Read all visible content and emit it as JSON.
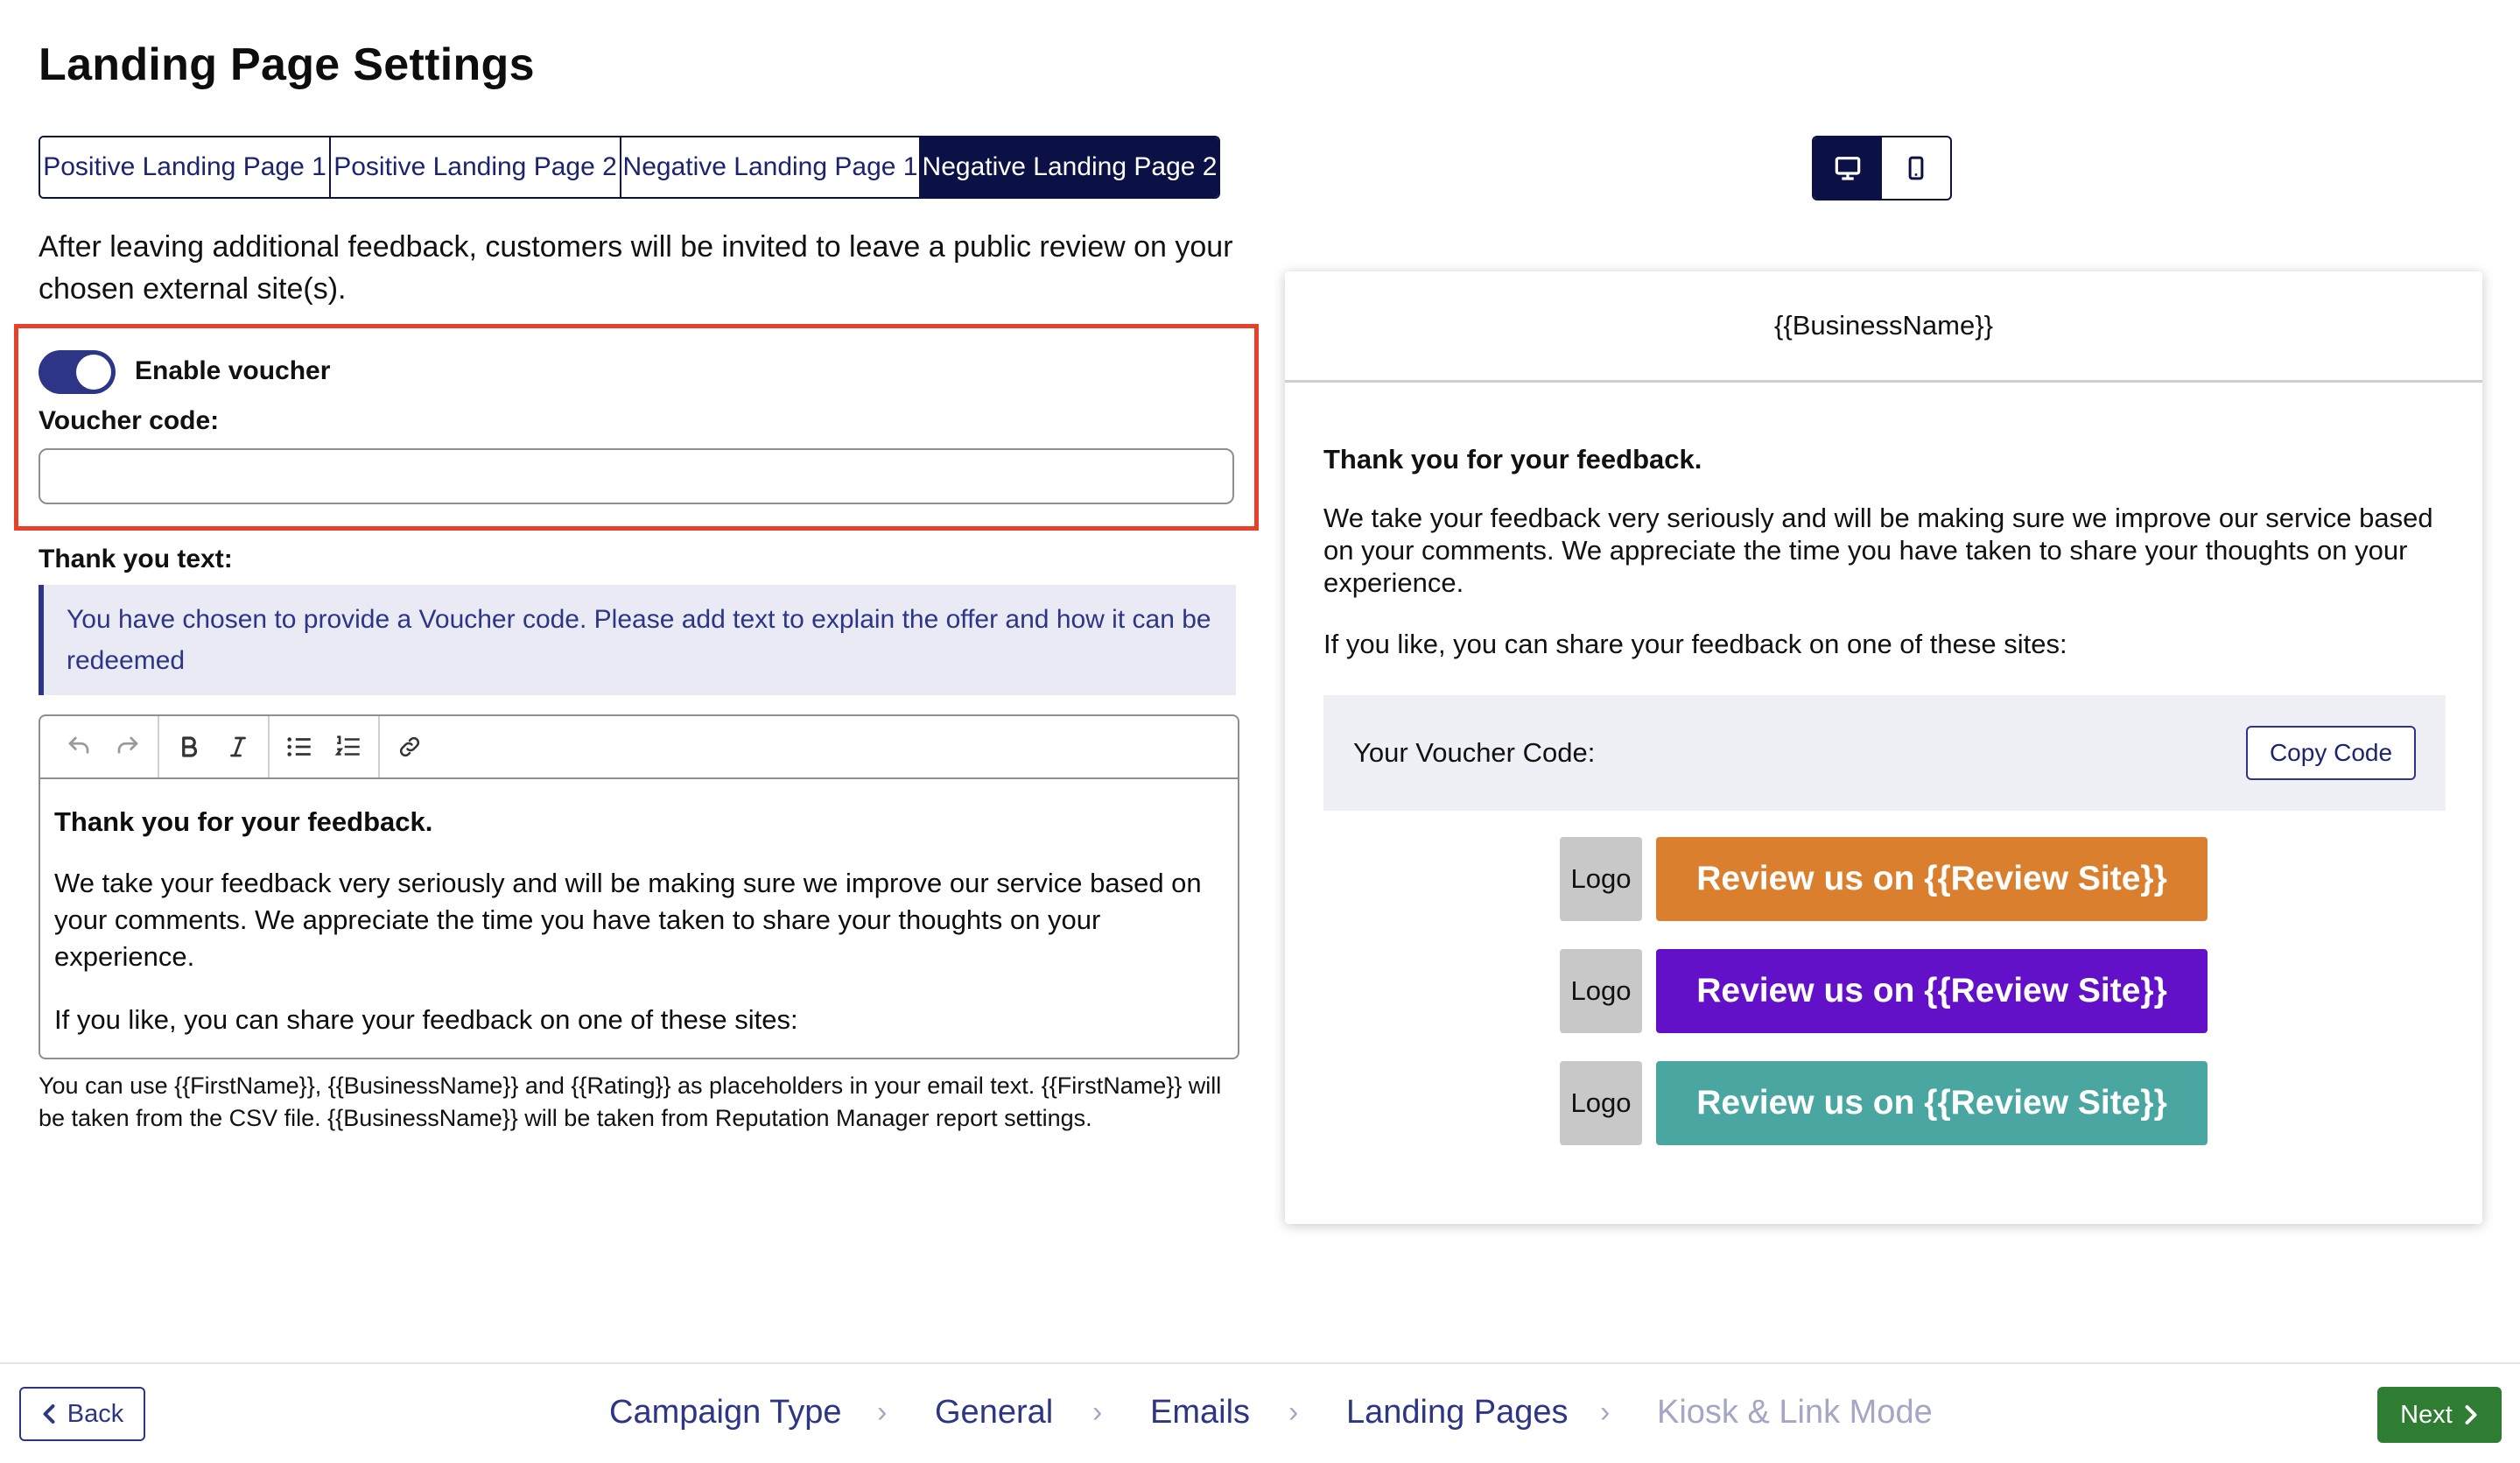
{
  "page": {
    "title": "Landing Page Settings"
  },
  "tabs": [
    {
      "label": "Positive Landing Page 1",
      "active": false
    },
    {
      "label": "Positive Landing Page 2",
      "active": false
    },
    {
      "label": "Negative Landing Page 1",
      "active": false
    },
    {
      "label": "Negative Landing Page 2",
      "active": true
    }
  ],
  "intro": "After leaving additional feedback, customers will be invited to leave a public review on your chosen external site(s).",
  "voucher": {
    "toggle_label": "Enable voucher",
    "enabled": true,
    "code_label": "Voucher code:",
    "code_value": "",
    "highlight_color": "#e6412b"
  },
  "thank_you": {
    "label": "Thank you text:",
    "notice": "You have chosen to provide a Voucher code. Please add text to explain the offer and how it can be redeemed"
  },
  "editor": {
    "toolbar_icons": [
      "undo-icon",
      "redo-icon",
      "bold-icon",
      "italic-icon",
      "bullet-list-icon",
      "numbered-list-icon",
      "link-icon"
    ],
    "content": {
      "title": "Thank you for your feedback.",
      "p1": "We take your feedback very seriously and will be making sure we improve our service based on your comments. We appreciate the time you have taken to share your thoughts on your experience.",
      "p2": "If you like, you can share your feedback on one of these sites:"
    }
  },
  "help_text": "You can use {{FirstName}}, {{BusinessName}} and {{Rating}} as placeholders in your email text. {{FirstName}} will be taken from the CSV file. {{BusinessName}} will be taken from Reputation Manager report settings.",
  "device_toggle": {
    "desktop_icon": "desktop-icon",
    "mobile_icon": "mobile-icon",
    "active": "desktop"
  },
  "preview": {
    "header": "{{BusinessName}}",
    "title": "Thank you for your feedback.",
    "p1": "We take your feedback very seriously and will be making sure we improve our service based on your comments. We appreciate the time you have taken to share your thoughts on your experience.",
    "p2": "If you like, you can share your feedback on one of these sites:",
    "voucher_label": "Your Voucher Code:",
    "copy_button": "Copy Code",
    "sites": [
      {
        "logo": "Logo",
        "button": "Review us on {{Review Site}}",
        "color": "#d97f2e"
      },
      {
        "logo": "Logo",
        "button": "Review us on {{Review Site}}",
        "color": "#6211c9"
      },
      {
        "logo": "Logo",
        "button": "Review us on {{Review Site}}",
        "color": "#4aa6a1"
      }
    ]
  },
  "footer": {
    "back": "Back",
    "next": "Next",
    "steps": [
      {
        "label": "Campaign Type",
        "enabled": true
      },
      {
        "label": "General",
        "enabled": true
      },
      {
        "label": "Emails",
        "enabled": true
      },
      {
        "label": "Landing Pages",
        "enabled": true
      },
      {
        "label": "Kiosk & Link Mode",
        "enabled": false
      }
    ]
  }
}
